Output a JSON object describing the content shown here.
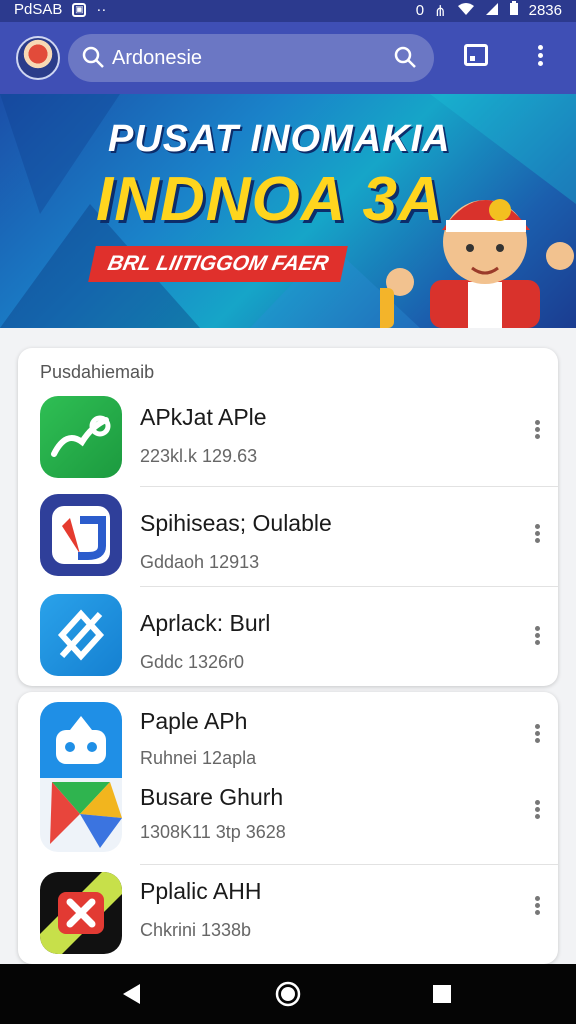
{
  "status_bar": {
    "left_text": "PdSAB",
    "left_icon": "app-notification-icon",
    "left_dots": "··",
    "right_icons": [
      "sync-icon",
      "signal-icon",
      "wifi-icon",
      "cell-signal-icon",
      "battery-icon"
    ],
    "time": "2836"
  },
  "app_bar": {
    "search_text": "Ardonesie",
    "avatar": "avatar-icon",
    "cast_icon": "cast-icon",
    "menu_icon": "more-vert-icon"
  },
  "banner": {
    "line1": "PUSAT INOMAKIA",
    "line2": "INDNOA 3A",
    "ribbon": "BRL LIITIGGOM FAER"
  },
  "section": {
    "title": "Pusdahiemaib"
  },
  "apps_card1": [
    {
      "name": "APkJat APle",
      "meta": "223kl.k 129.63",
      "icon": "green-app-icon"
    },
    {
      "name": "Spihiseas; Oulable",
      "meta": "Gddaoh 12913",
      "icon": "blue-g-app-icon"
    },
    {
      "name": "Aprlack: Burl",
      "meta": "Gddc 1326r0",
      "icon": "blue-slash-app-icon"
    }
  ],
  "apps_card2": [
    {
      "name": "Paple APh",
      "meta": "Ruhnei 12apla",
      "icon": "robot-app-icon"
    },
    {
      "name": "Busare Ghurh",
      "meta": "1308K11 3tp 3628",
      "icon": "play-app-icon"
    },
    {
      "name": "Pplalic AHH",
      "meta": "Chkrini 1338b",
      "icon": "red-x-app-icon"
    }
  ],
  "nav": {
    "back": "back-icon",
    "home": "home-icon",
    "recents": "recents-icon"
  },
  "colors": {
    "appbar": "#3f4fb5",
    "status": "#2c3a8e",
    "accent_yellow": "#ffd51e",
    "accent_red": "#e0302c"
  }
}
